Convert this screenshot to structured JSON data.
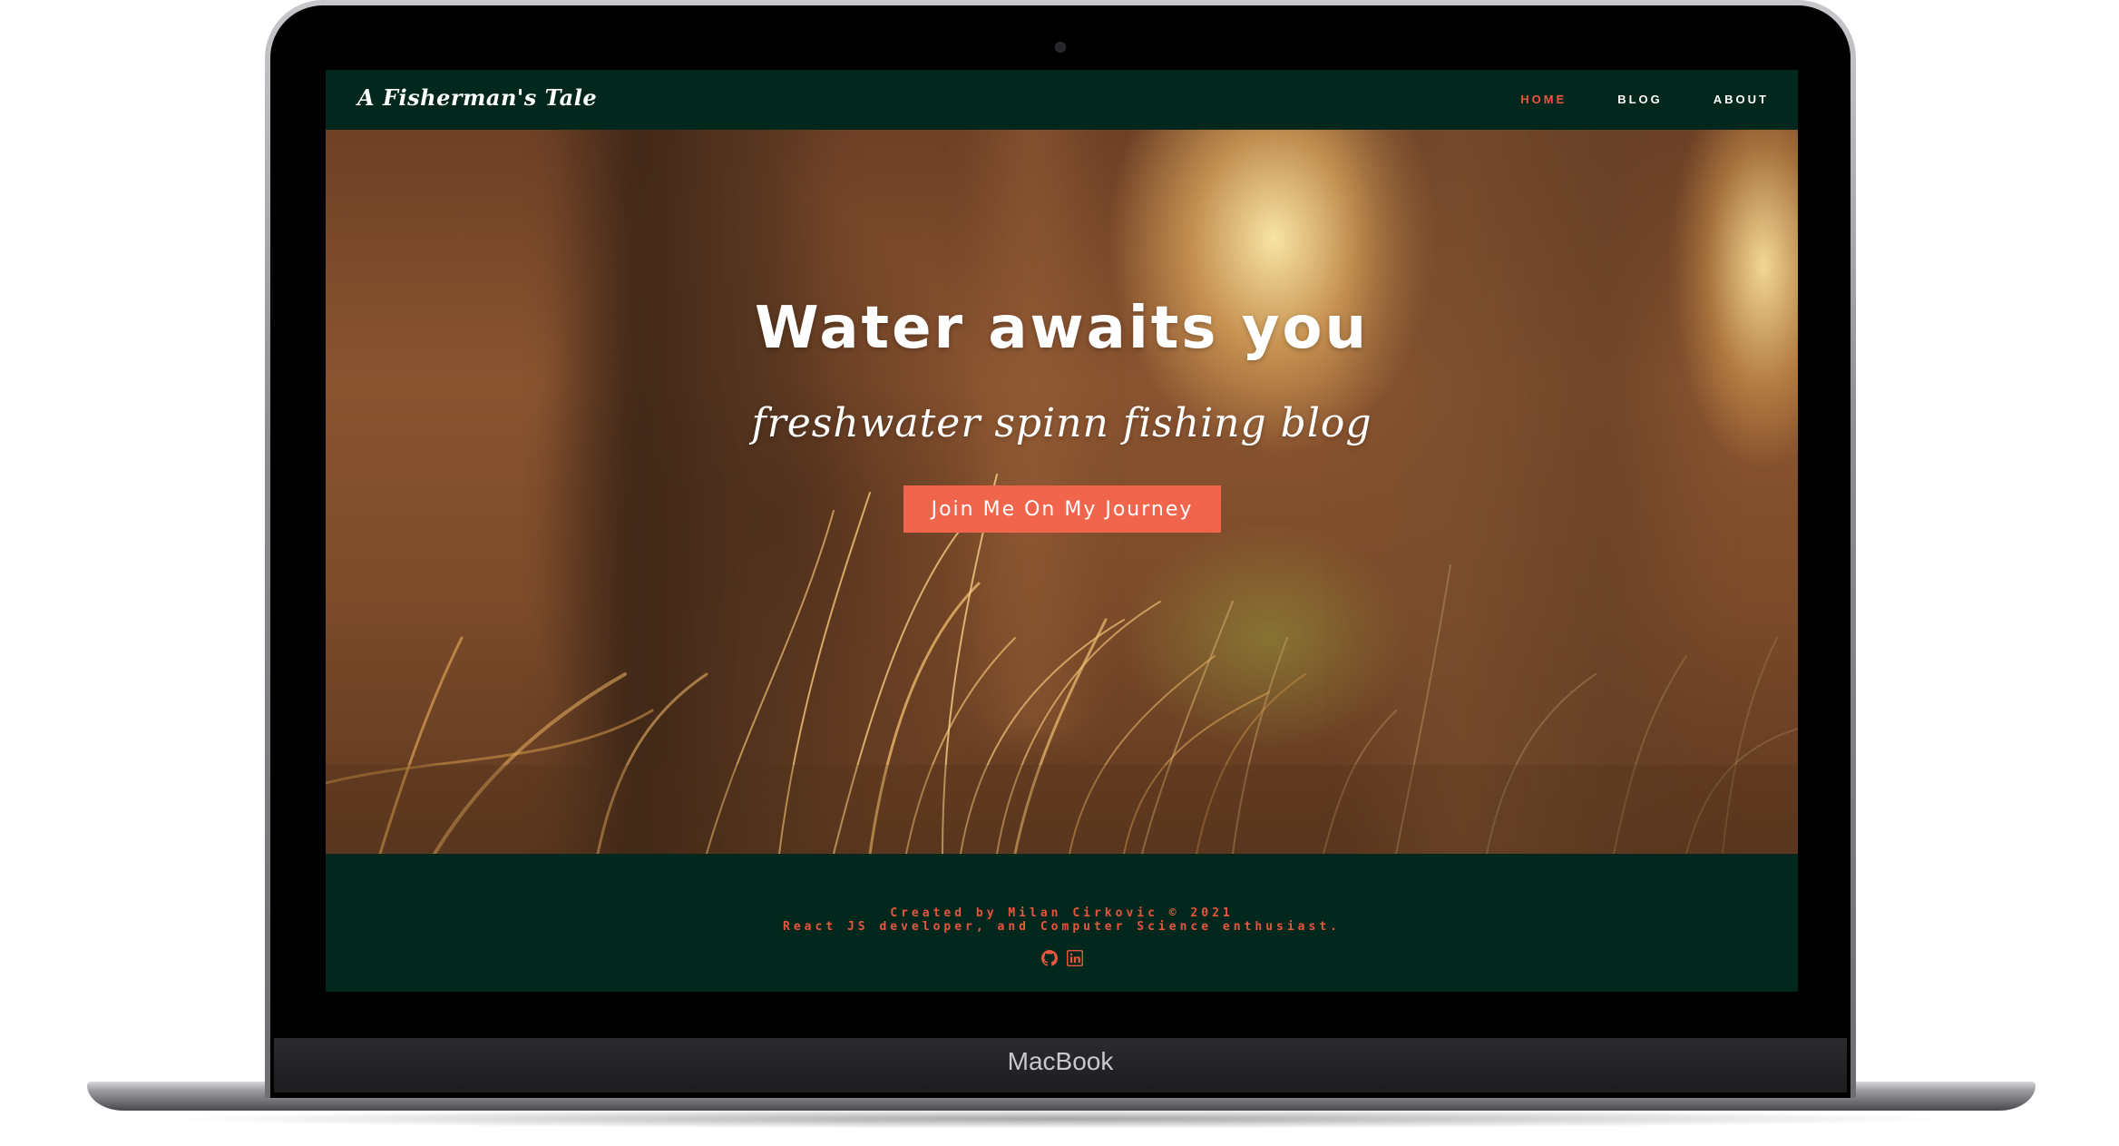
{
  "device": {
    "brand_label": "MacBook"
  },
  "site": {
    "brand": "A Fisherman's Tale",
    "nav": [
      {
        "label": "HOME",
        "active": true
      },
      {
        "label": "BLOG",
        "active": false
      },
      {
        "label": "ABOUT",
        "active": false
      }
    ]
  },
  "hero": {
    "title": "Water awaits you",
    "subtitle": "freshwater spinn fishing blog",
    "cta_label": "Join Me On My Journey"
  },
  "footer": {
    "line1": "Created by Milan Cirkovic © 2021",
    "line2": "React JS developer, and Computer Science enthusiast.",
    "icons": [
      "github-icon",
      "linkedin-icon"
    ]
  },
  "colors": {
    "accent": "#f1654c",
    "nav_active": "#e8563f",
    "dark_green": "#02271d"
  }
}
